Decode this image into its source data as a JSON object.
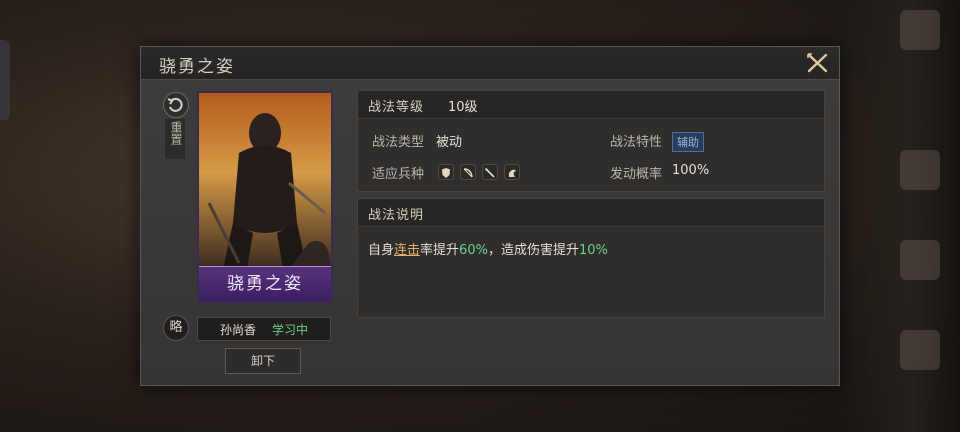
{
  "dialog": {
    "title": "骁勇之姿",
    "reset_label": "重置",
    "card_name": "骁勇之姿",
    "lue_label": "略",
    "hero_name": "孙尚香",
    "status": "学习中",
    "unequip_label": "卸下"
  },
  "tactic": {
    "level_label": "战法等级",
    "level_value": "10级",
    "type_label": "战法类型",
    "type_value": "被动",
    "trait_label": "战法特性",
    "trait_badge": "辅助",
    "troops_label": "适应兵种",
    "troops_icons": [
      "shield-icon",
      "bow-icon",
      "spear-icon",
      "horse-icon"
    ],
    "chance_label": "发动概率",
    "chance_value": "100%",
    "desc_header": "战法说明",
    "desc": {
      "part1": "自身",
      "link": "连击",
      "part2": "率提升",
      "value1": "60%",
      "part3": "，造成伤害提升",
      "value2": "10%"
    }
  },
  "colors": {
    "accent_green": "#6fd28a",
    "link_gold": "#e0b36a",
    "badge_blue": "#8fb3e6",
    "card_purple": "#5a2f8c"
  }
}
